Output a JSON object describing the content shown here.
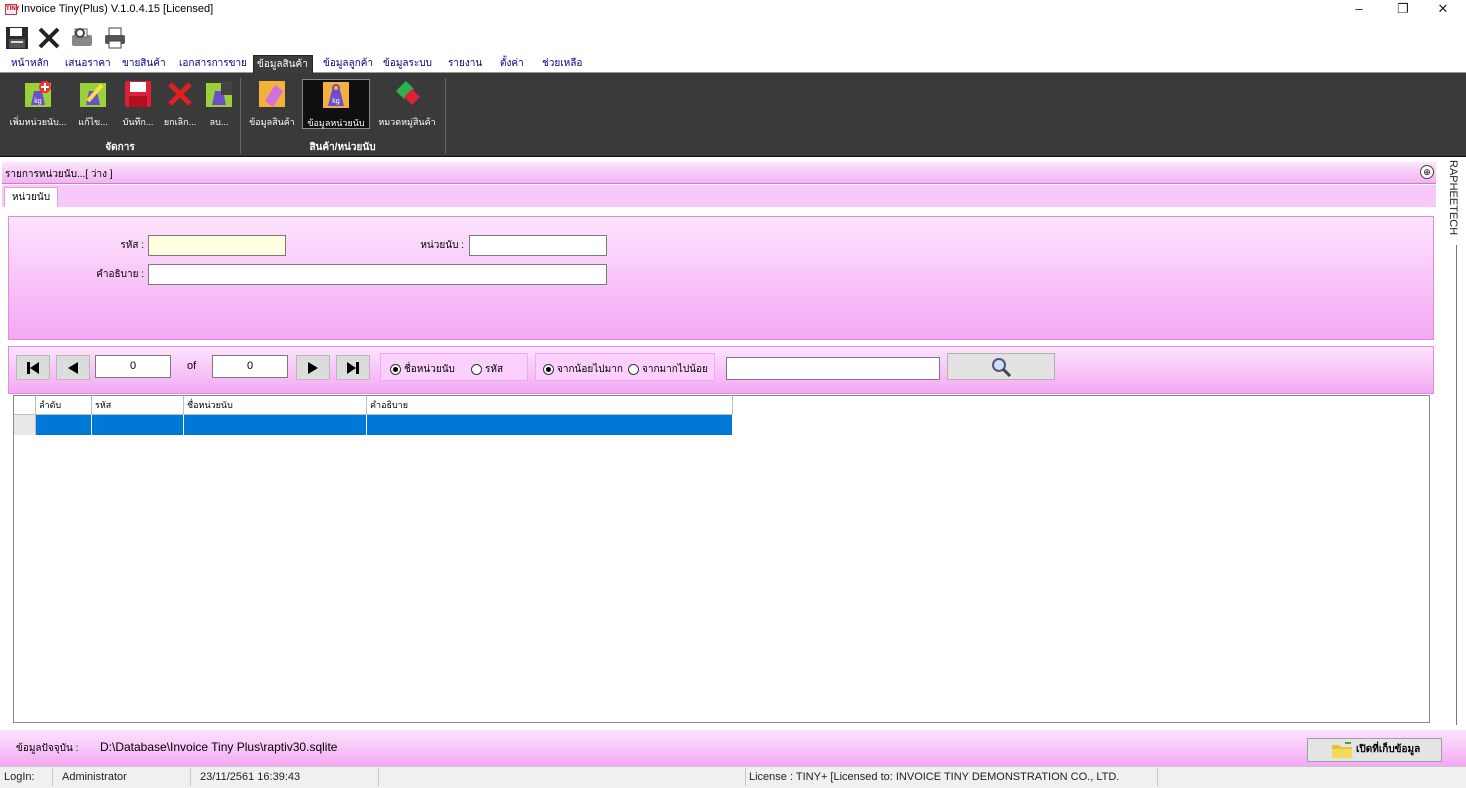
{
  "window": {
    "title": "Invoice Tiny(Plus)  V.1.0.4.15 [Licensed]",
    "app_icon_text": "TINY",
    "minimize": "–",
    "restore": "❐",
    "close": "✕"
  },
  "menu": {
    "tabs": [
      "หน้าหลัก",
      "เสนอราคา",
      "ขายสินค้า",
      "เอกสารการขาย",
      "ข้อมูลสินค้า",
      "ข้อมูลลูกค้า",
      "ข้อมูลระบบ",
      "รายงาน",
      "ตั้งค่า",
      "ช่วยเหลือ"
    ],
    "active": "ข้อมูลสินค้า"
  },
  "ribbon": {
    "manage_group": "จัดการ",
    "product_group": "สินค้า/หน่วยนับ",
    "buttons": {
      "add": "เพิ่มหน่วยนับ...",
      "edit": "แก้ไข...",
      "save": "บันทึก...",
      "cancel": "ยกเลิก...",
      "delete": "ลบ...",
      "product_info": "ข้อมูลสินค้า",
      "unit_info": "ข้อมูลหน่วยนับ",
      "category": "หมวดหมู่สินค้า"
    },
    "kg": "kg"
  },
  "panel": {
    "title": "รายการหน่วยนับ...[ ว่าง ]",
    "collapse": "⊕",
    "tab": "หน่วยนับ"
  },
  "form": {
    "code_label": "รหัส :",
    "code_value": "",
    "unit_label": "หน่วยนับ :",
    "unit_value": "",
    "desc_label": "คำอธิบาย :",
    "desc_value": ""
  },
  "navigator": {
    "first": "⏮",
    "prev": "◀",
    "current": "0",
    "of": "of",
    "total": "0",
    "next": "▶",
    "last": "⏭"
  },
  "sort_field": {
    "options": [
      "ชื่อหน่วยนับ",
      "รหัส"
    ],
    "selected": "ชื่อหน่วยนับ"
  },
  "sort_order": {
    "options": [
      "จากน้อยไปมาก",
      "จากมากไปน้อย"
    ],
    "selected": "จากน้อยไปมาก"
  },
  "search": {
    "value": ""
  },
  "grid": {
    "columns": [
      "ลำดับ",
      "รหัส",
      "ชื่อหน่วยนับ",
      "คำอธิบาย"
    ],
    "rows": [
      [
        "",
        "",
        "",
        ""
      ]
    ]
  },
  "side_brand": "RAPHEETECH",
  "footer": {
    "db_label": "ข้อมูลปัจจุบัน :",
    "db_path": "D:\\Database\\Invoice Tiny Plus\\raptiv30.sqlite",
    "open_button": "เปิดที่เก็บข้อมูล"
  },
  "status": {
    "login_label": "LogIn:",
    "user": "Administrator",
    "datetime": "23/11/2561 16:39:43",
    "license": "License : TINY+ [Licensed to: INVOICE TINY DEMONSTRATION CO., LTD."
  },
  "colors": {
    "ribbon_bg": "#3a3a3a",
    "pink_panel": "#f3a8f3",
    "grid_selected": "#0078d7"
  }
}
